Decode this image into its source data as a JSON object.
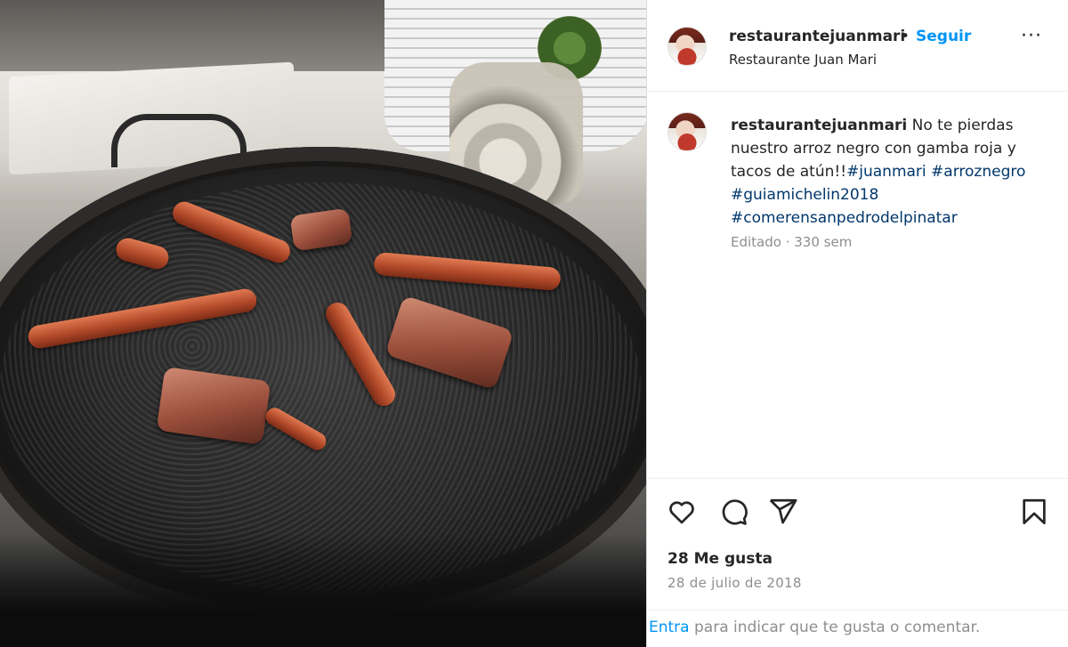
{
  "post": {
    "image_alt": "Paella de arroz negro con gamba roja y tacos de atún",
    "author": {
      "username": "restaurantejuanmari",
      "location": "Restaurante Juan Mari"
    },
    "header": {
      "separator": "•",
      "follow_label": "Seguir",
      "more_label": "···"
    },
    "caption": {
      "username": "restaurantejuanmari",
      "text": "No te pierdas nuestro arroz negro con gamba roja y tacos de atún!!",
      "hashtags": [
        "#juanmari",
        "#arroznegro",
        "#guiamichelin2018",
        "#comerensanpedrodelpinatar"
      ],
      "edited_label": "Editado",
      "meta_separator": " · ",
      "age": "330 sem"
    },
    "actions": {
      "like_icon": "heart-icon",
      "comment_icon": "comment-icon",
      "share_icon": "send-icon",
      "save_icon": "bookmark-icon"
    },
    "likes_text": "28 Me gusta",
    "date_text": "28 de julio de 2018",
    "login_prompt": {
      "link": "Entra",
      "rest": "para indicar que te gusta o comentar."
    }
  },
  "colors": {
    "link_blue": "#0095f6",
    "hashtag_blue": "#00376b",
    "text": "#262626",
    "muted": "#8e8e8e"
  }
}
